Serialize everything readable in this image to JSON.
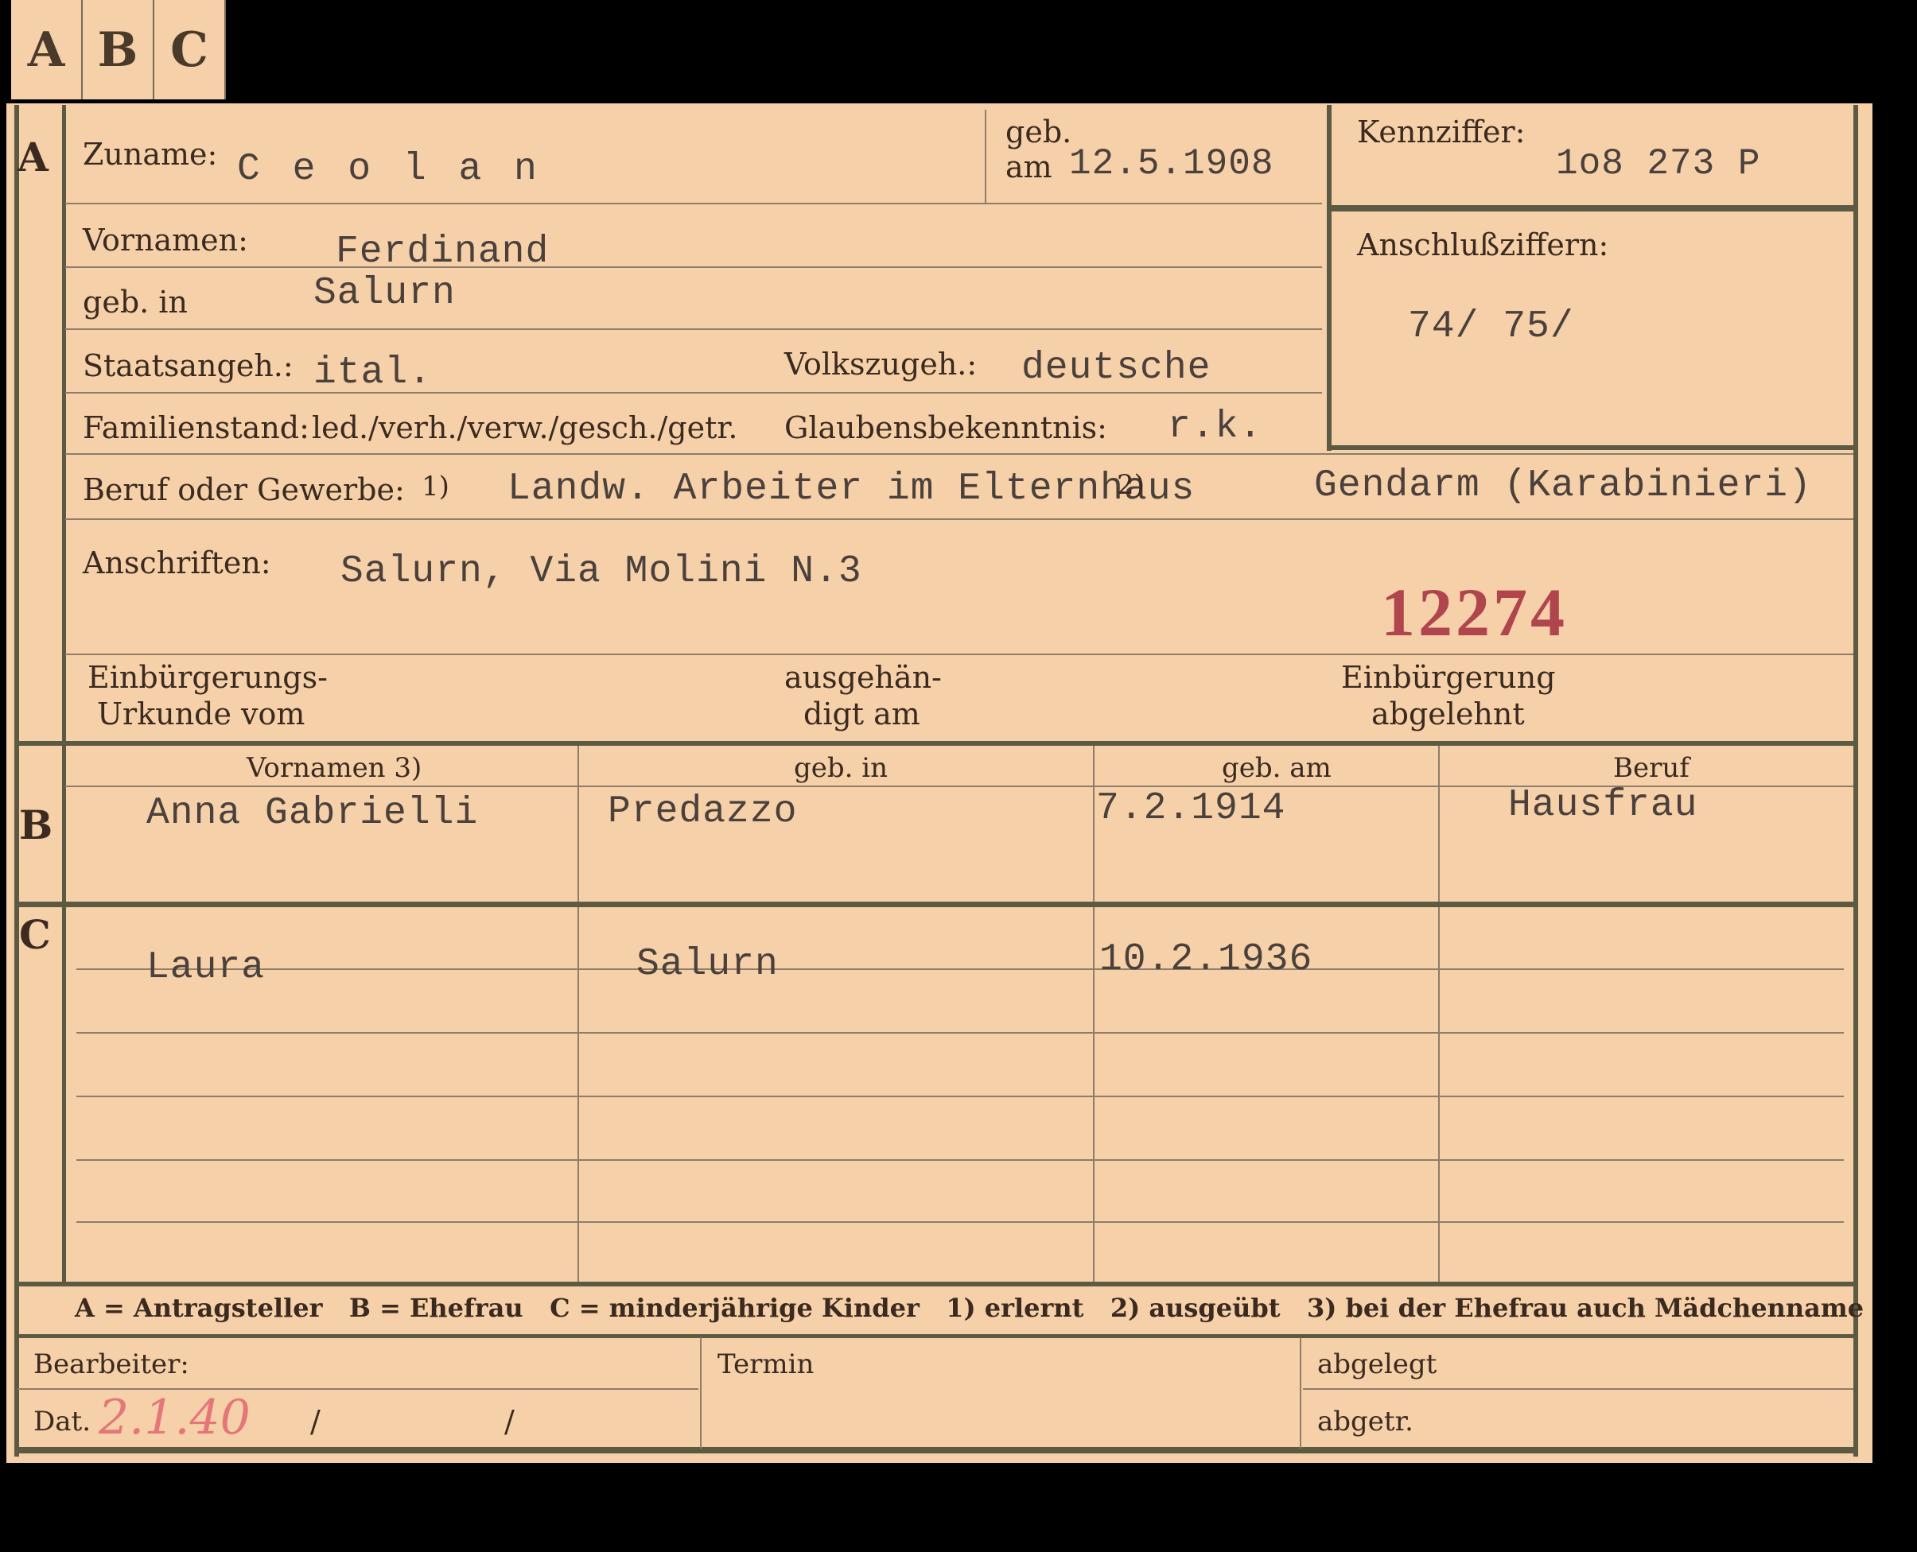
{
  "tabs": [
    "A",
    "B",
    "C"
  ],
  "section_marks": {
    "a": "A",
    "b": "B",
    "c": "C"
  },
  "applicant": {
    "surname_label": "Zuname:",
    "surname": "C e o l a n",
    "dob_label_1": "geb.",
    "dob_label_2": "am",
    "dob": "12.5.1908",
    "id_label": "Kennziffer:",
    "id_value": "1o8 273  P",
    "join_label": "Anschlußziffern:",
    "join_values": "74/ 75/",
    "firstnames_label": "Vornamen:",
    "firstnames": "Ferdinand",
    "birthplace_label": "geb. in",
    "birthplace": "Salurn",
    "citizenship_label": "Staatsangeh.:",
    "citizenship": "ital.",
    "ethnicity_label": "Volkszugeh.:",
    "ethnicity": "deutsche",
    "marital_label": "Familienstand:",
    "marital_options": "led./verh./verw./gesch./getr.",
    "religion_label": "Glaubensbekenntnis:",
    "religion": "r.k.",
    "occupation_label": "Beruf oder Gewerbe:",
    "occupation_note": "1)",
    "occupation_learned": "Landw. Arbeiter im Elternhaus",
    "occupation_marker": "2)",
    "occupation_practiced": "Gendarm (Karabinieri)",
    "address_label": "Anschriften:",
    "address": "Salurn, Via Molini N.3",
    "stamp_number": "12274",
    "naturalization_doc_1": "Einbürgerungs-",
    "naturalization_doc_2": "Urkunde vom",
    "handed_1": "ausgehän-",
    "handed_2": "digt am",
    "rejected_1": "Einbürgerung",
    "rejected_2": "abgelehnt"
  },
  "family_table": {
    "headers": [
      "Vornamen 3)",
      "geb. in",
      "geb. am",
      "Beruf"
    ],
    "wife": [
      "Anna Gabrielli",
      "Predazzo",
      "7.2.1914",
      "Hausfrau"
    ],
    "children": [
      [
        "Laura",
        "Salurn",
        "10.2.1936",
        ""
      ]
    ]
  },
  "legend": "A = Antragsteller   B = Ehefrau   C = minderjährige Kinder   1) erlernt   2) ausgeübt   3) bei der Ehefrau auch Mädchenname",
  "footer": {
    "clerk_label": "Bearbeiter:",
    "date_label": "Dat.",
    "date_value": "2.1.40",
    "slash_1": "/",
    "slash_2": "/",
    "term_label": "Termin",
    "filed_label": "abgelegt",
    "ceded_label": "abgetr."
  },
  "colors": {
    "card": "#f5d0a8",
    "border": "#5d5a43",
    "stamp": "#b0454e",
    "pencil": "#e0606e"
  }
}
